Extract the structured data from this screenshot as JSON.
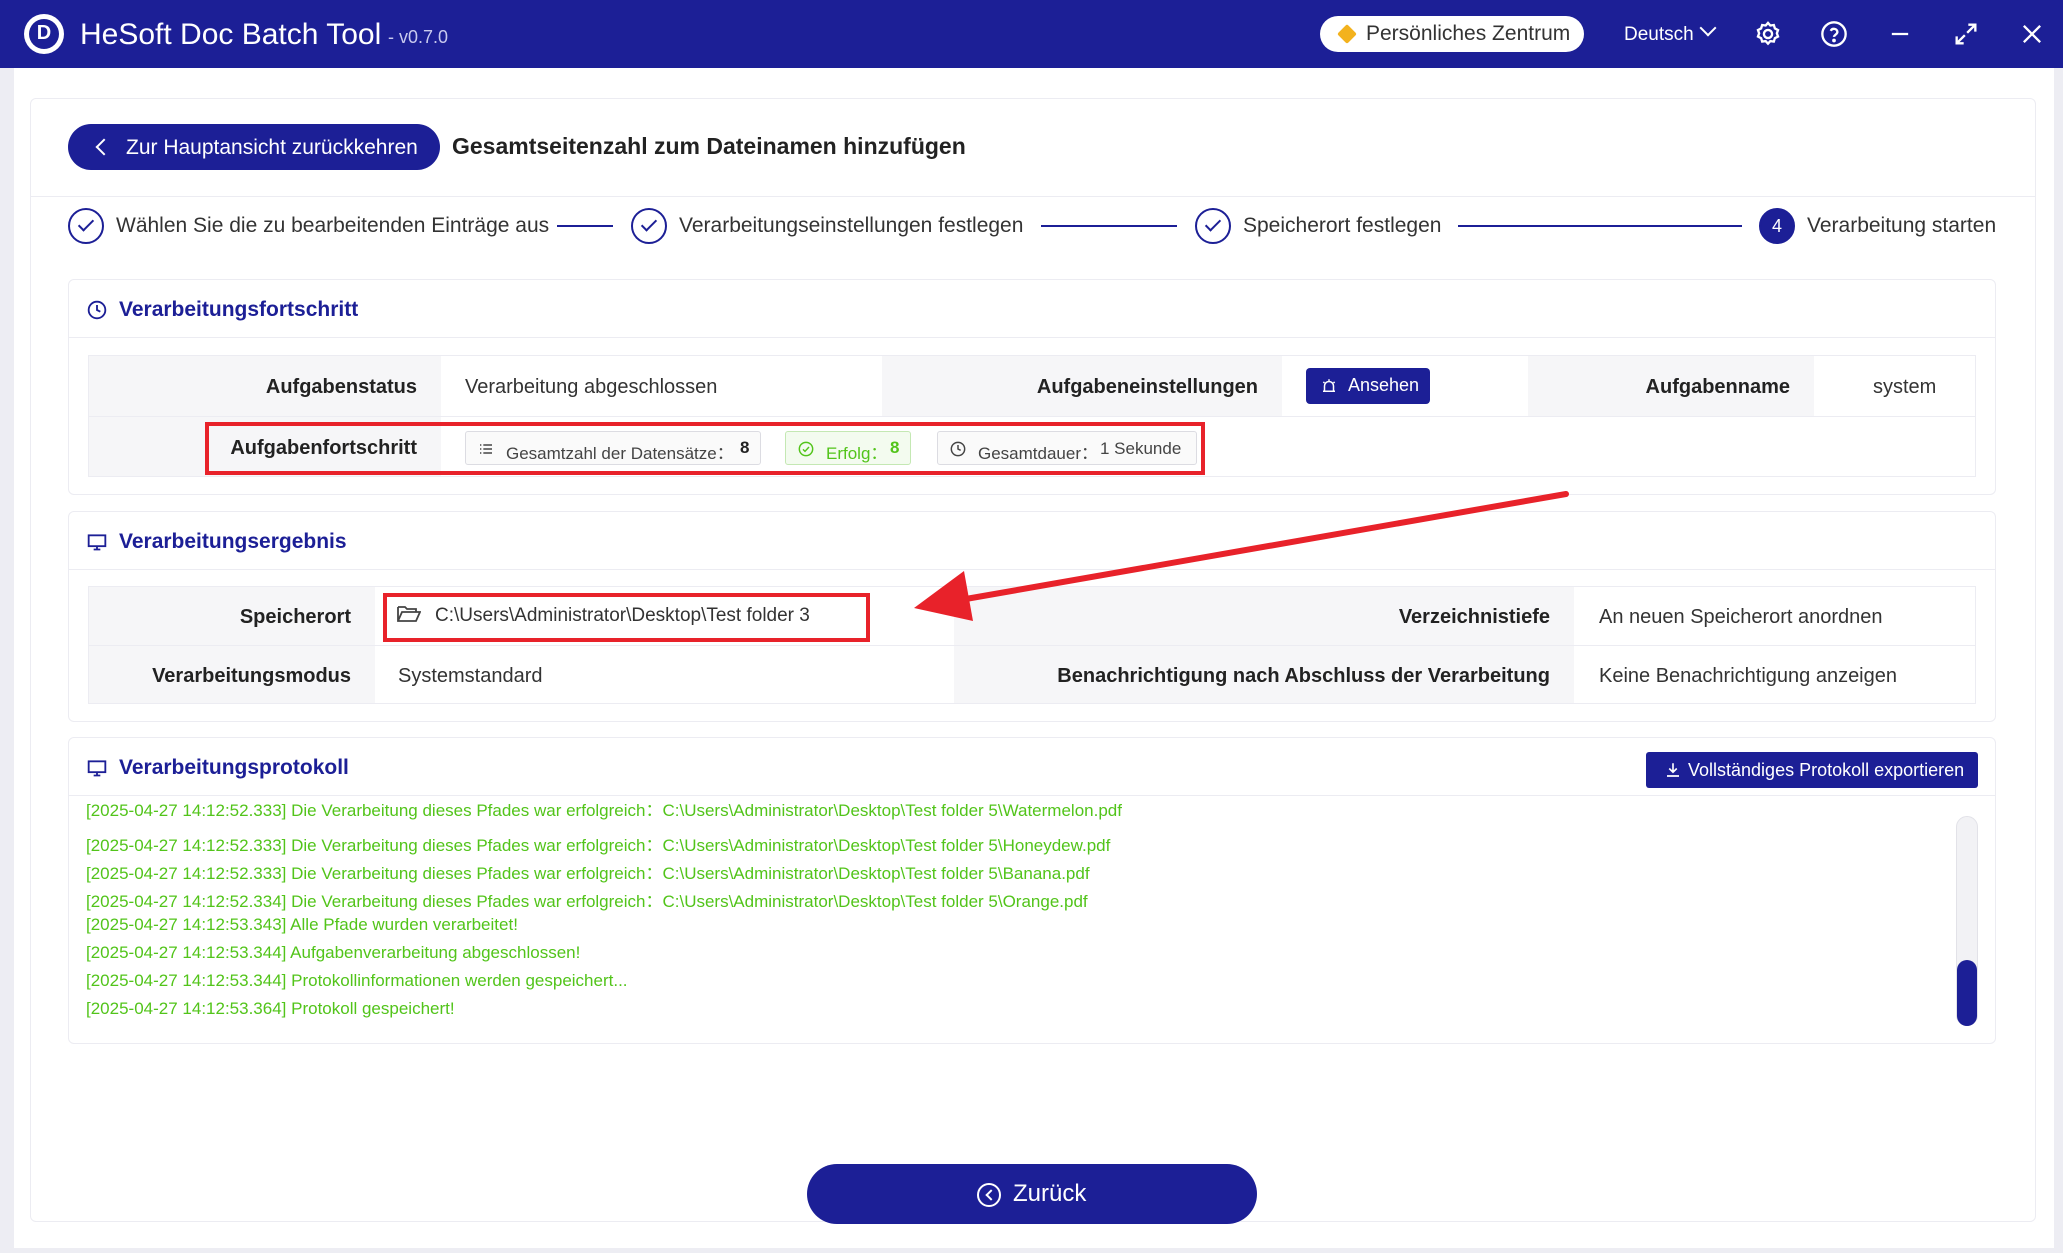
{
  "window": {
    "app_name": "HeSoft Doc Batch Tool",
    "version": "- v0.7.0",
    "logo_letter": "D",
    "personal_center": "Persönliches Zentrum",
    "language": "Deutsch"
  },
  "header": {
    "back_label": "Zur Hauptansicht zurückkehren",
    "page_title": "Gesamtseitenzahl zum Dateinamen hinzufügen"
  },
  "steps": [
    {
      "label": "Wählen Sie die zu bearbeitenden Einträge aus",
      "state": "done"
    },
    {
      "label": "Verarbeitungseinstellungen festlegen",
      "state": "done"
    },
    {
      "label": "Speicherort festlegen",
      "state": "done"
    },
    {
      "label": "Verarbeitung starten",
      "state": "active",
      "number": "4"
    }
  ],
  "progress": {
    "title": "Verarbeitungsfortschritt",
    "status_label": "Aufgabenstatus",
    "status_value": "Verarbeitung abgeschlossen",
    "settings_label": "Aufgabeneinstellungen",
    "view_button": "Ansehen",
    "name_label": "Aufgabenname",
    "name_value": "system",
    "task_progress_label": "Aufgabenfortschritt",
    "total_label": "Gesamtzahl der Datensätze：",
    "total_value": "8",
    "success_label": "Erfolg：",
    "success_value": "8",
    "duration_label": "Gesamtdauer：",
    "duration_value": "1 Sekunde"
  },
  "result": {
    "title": "Verarbeitungsergebnis",
    "location_label": "Speicherort",
    "location_value": "C:\\Users\\Administrator\\Desktop\\Test folder 3",
    "depth_label": "Verzeichnistiefe",
    "depth_value": "An neuen Speicherort anordnen",
    "mode_label": "Verarbeitungsmodus",
    "mode_value": "Systemstandard",
    "notify_label": "Benachrichtigung nach Abschluss der Verarbeitung",
    "notify_value": "Keine Benachrichtigung anzeigen"
  },
  "log": {
    "title": "Verarbeitungsprotokoll",
    "export_button": "Vollständiges Protokoll exportieren",
    "lines": [
      "[2025-04-27 14:12:52.333] Die Verarbeitung dieses Pfades war erfolgreich：C:\\Users\\Administrator\\Desktop\\Test folder 5\\Watermelon.pdf",
      "[2025-04-27 14:12:52.333] Die Verarbeitung dieses Pfades war erfolgreich：C:\\Users\\Administrator\\Desktop\\Test folder 5\\Honeydew.pdf",
      "[2025-04-27 14:12:52.333] Die Verarbeitung dieses Pfades war erfolgreich：C:\\Users\\Administrator\\Desktop\\Test folder 5\\Banana.pdf",
      "[2025-04-27 14:12:52.334] Die Verarbeitung dieses Pfades war erfolgreich：C:\\Users\\Administrator\\Desktop\\Test folder 5\\Orange.pdf",
      "[2025-04-27 14:12:53.343] Alle Pfade wurden verarbeitet!",
      "[2025-04-27 14:12:53.344] Aufgabenverarbeitung abgeschlossen!",
      "[2025-04-27 14:12:53.344] Protokollinformationen werden gespeichert...",
      "[2025-04-27 14:12:53.364] Protokoll gespeichert!"
    ]
  },
  "footer": {
    "back_button": "Zurück"
  },
  "colors": {
    "primary": "#1c1f96",
    "success": "#52c41a",
    "highlight": "#e8222a"
  }
}
